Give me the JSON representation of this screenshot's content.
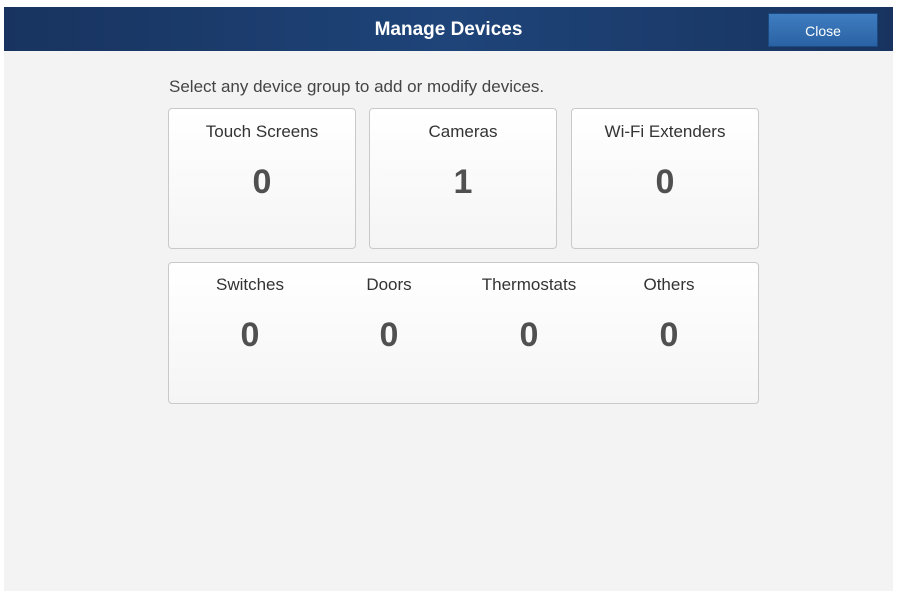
{
  "header": {
    "title": "Manage Devices",
    "close_label": "Close"
  },
  "instruction": "Select any device group to add or modify devices.",
  "device_groups": [
    {
      "label": "Touch Screens",
      "count": "0"
    },
    {
      "label": "Cameras",
      "count": "1"
    },
    {
      "label": "Wi-Fi Extenders",
      "count": "0"
    }
  ],
  "other_devices": [
    {
      "label": "Switches",
      "count": "0"
    },
    {
      "label": "Doors",
      "count": "0"
    },
    {
      "label": "Thermostats",
      "count": "0"
    },
    {
      "label": "Others",
      "count": "0"
    }
  ],
  "colors": {
    "header_bg": "#1e4479",
    "close_button": "#2f6cb0",
    "panel_bg": "#f3f3f3"
  }
}
